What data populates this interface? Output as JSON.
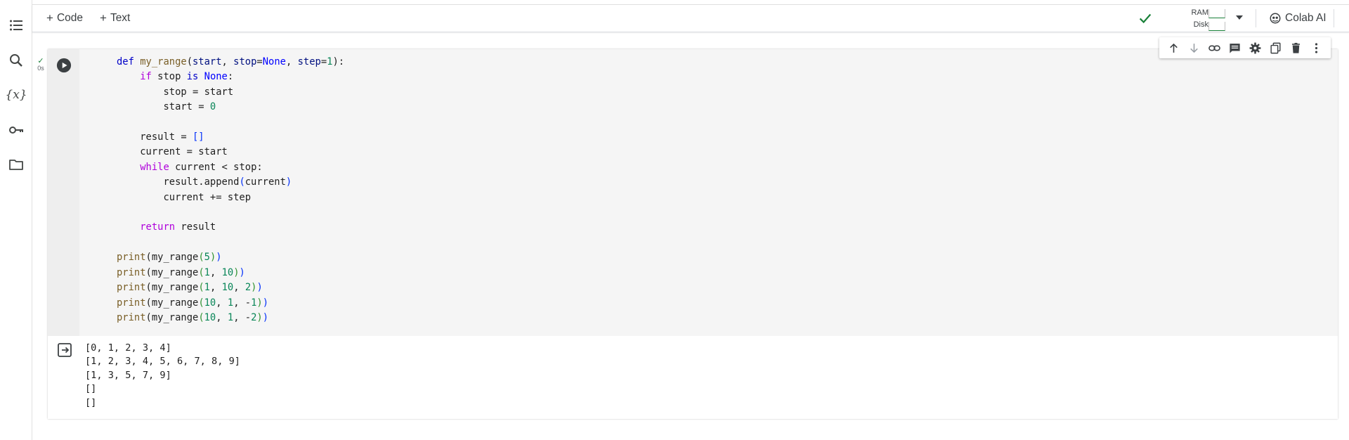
{
  "toolbar": {
    "add_code_label": "Code",
    "add_text_label": "Text",
    "resources": {
      "ram_label": "RAM",
      "disk_label": "Disk"
    },
    "colab_ai_label": "Colab AI"
  },
  "sidebar": {
    "items": [
      {
        "icon": "table-of-contents-icon"
      },
      {
        "icon": "search-icon"
      },
      {
        "icon": "variables-icon",
        "glyph": "{x}"
      },
      {
        "icon": "secrets-key-icon"
      },
      {
        "icon": "files-folder-icon"
      }
    ]
  },
  "cell": {
    "exec_time": "0s",
    "status": "success",
    "code_lines": [
      "def my_range(start, stop=None, step=1):",
      "    if stop is None:",
      "        stop = start",
      "        start = 0",
      "",
      "    result = []",
      "    current = start",
      "    while current < stop:",
      "        result.append(current)",
      "        current += step",
      "",
      "    return result",
      "",
      "print(my_range(5))",
      "print(my_range(1, 10))",
      "print(my_range(1, 10, 2))",
      "print(my_range(10, 1, -1))",
      "print(my_range(10, 1, -2))"
    ],
    "output_lines": [
      "[0, 1, 2, 3, 4]",
      "[1, 2, 3, 4, 5, 6, 7, 8, 9]",
      "[1, 3, 5, 7, 9]",
      "[]",
      "[]"
    ],
    "toolbar_icons": [
      "move-up-icon",
      "move-down-icon",
      "link-icon",
      "comment-icon",
      "settings-gear-icon",
      "mirror-cell-icon",
      "delete-trash-icon",
      "more-vert-icon"
    ]
  },
  "colors": {
    "accent_green": "#188038",
    "code_bg": "#f5f5f5",
    "keyword": "#0000c8",
    "control_keyword": "#af00db",
    "number": "#098658"
  }
}
